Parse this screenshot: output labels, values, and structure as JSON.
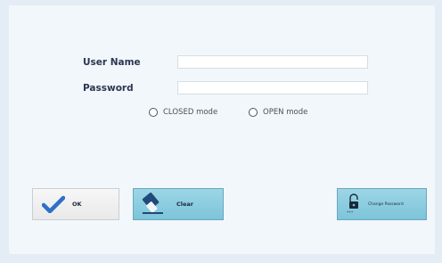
{
  "login": {
    "username_label": "User Name",
    "password_label": "Password",
    "username_value": "",
    "password_value": "",
    "mode_closed_label": "CLOSED mode",
    "mode_open_label": "OPEN mode"
  },
  "buttons": {
    "ok_label": "OK",
    "clear_label": "Clear",
    "change_password_label": "Change Password"
  },
  "colors": {
    "accent_blue": "#7dc4da",
    "check_blue": "#2f6fc7"
  }
}
